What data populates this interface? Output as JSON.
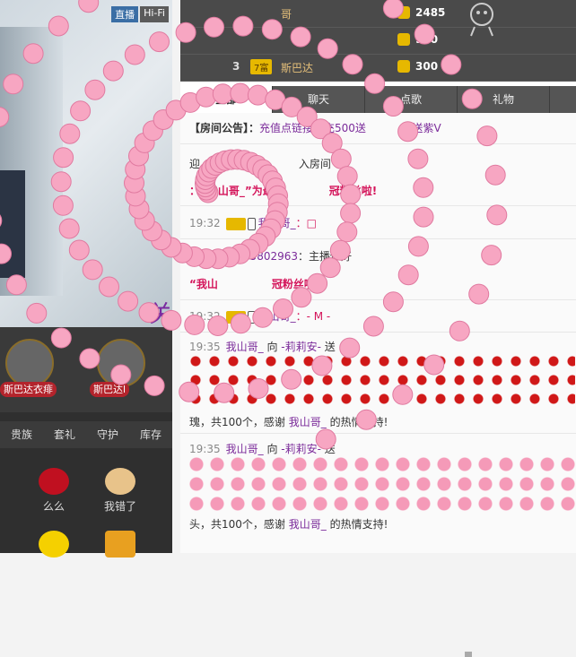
{
  "video": {
    "badges": [
      "直播",
      "Hi-Fi"
    ]
  },
  "left_banner_char": "关",
  "anchors": [
    {
      "label": "斯巴达衣痱"
    },
    {
      "label": "斯巴达l"
    }
  ],
  "gift_tabs": [
    "贵族",
    "套礼",
    "守护",
    "库存"
  ],
  "gifts": [
    {
      "label": "么么",
      "icon": "kiss-icon"
    },
    {
      "label": "我错了",
      "icon": "cow-icon"
    },
    {
      "label": "",
      "icon": "duck-icon"
    },
    {
      "label": "",
      "icon": "beer-icon"
    }
  ],
  "rank": [
    {
      "num": "",
      "badge": "",
      "name": "哥",
      "value": "2485"
    },
    {
      "num": "",
      "badge": "",
      "name": "",
      "value": "920"
    },
    {
      "num": "3",
      "badge": "7富",
      "name": "斯巴达",
      "value": "300"
    }
  ],
  "chat_tabs": [
    "全部",
    "聊天",
    "点歌",
    "礼物"
  ],
  "chat": {
    "announcement": {
      "label": "【房间公告】：",
      "text": "充值点链接，充500送",
      "tail": "0送紫V"
    },
    "messages": [
      {
        "prefix": "迎",
        "user": "小游客",
        "text": "入房间"
      },
      {
        "text_red": "：“我山哥_”为最新",
        "tail_red": "冠粉丝啦!"
      },
      {
        "time": "19:32",
        "user": "我山哥_",
        "text": "：□"
      },
      {
        "time": "19:32",
        "user": "m145802963",
        "text": "：主播你好"
      },
      {
        "text_red": "“我山",
        "tail_red": "冠粉丝啦!"
      },
      {
        "time": "19:32",
        "user": "我山哥_",
        "text": "：- M -"
      },
      {
        "time": "19:35",
        "user": "我山哥_",
        "verb": "向",
        "target": "-莉莉安-",
        "send": "送"
      },
      {
        "text": "瑰，共100个，感谢",
        "user": "我山哥_",
        "tail": "的热情支持!"
      },
      {
        "time": "19:35",
        "user": "我山哥_",
        "verb": "向",
        "target": "-莉莉安-",
        "send": "送"
      },
      {
        "text": "头，共100个，感谢",
        "user": "我山哥_",
        "tail": "的热情支持!"
      }
    ]
  },
  "colors": {
    "accent": "#7b2b9a",
    "red": "#d4145a",
    "gold": "#e6b800",
    "pig": "#f59ab8"
  }
}
